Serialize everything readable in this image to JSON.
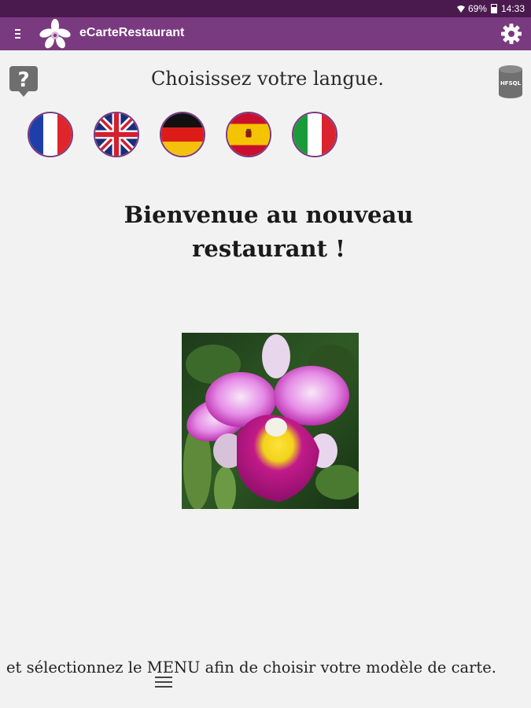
{
  "status_bar": {
    "battery": "69%",
    "time": "14:33",
    "icons": [
      "wifi-icon",
      "battery-icon"
    ]
  },
  "app_bar": {
    "title": "eCarteRestaurant",
    "menu_icon": "menu-icon",
    "logo_icon": "orchid-logo-icon",
    "settings_icon": "gear-icon",
    "background_color": "#7a3a80",
    "status_color": "#4a1a4f"
  },
  "toolbar": {
    "help_icon": "help-icon",
    "db_icon": "database-icon",
    "db_label": "HFSQL"
  },
  "language": {
    "prompt": "Choisissez votre langue.",
    "flags": [
      {
        "name": "french-flag",
        "icon": "france-flag-icon"
      },
      {
        "name": "english-flag",
        "icon": "uk-flag-icon"
      },
      {
        "name": "german-flag",
        "icon": "germany-flag-icon"
      },
      {
        "name": "spanish-flag",
        "icon": "spain-flag-icon"
      },
      {
        "name": "italian-flag",
        "icon": "italy-flag-icon"
      }
    ]
  },
  "welcome": {
    "line1": "Bienvenue au nouveau",
    "line2": "restaurant !"
  },
  "image": {
    "subject": "orchid-photo"
  },
  "footer": {
    "text": "et sélectionnez le MENU afin de choisir votre modèle de carte.",
    "menu_icon": "hamburger-menu-icon"
  }
}
